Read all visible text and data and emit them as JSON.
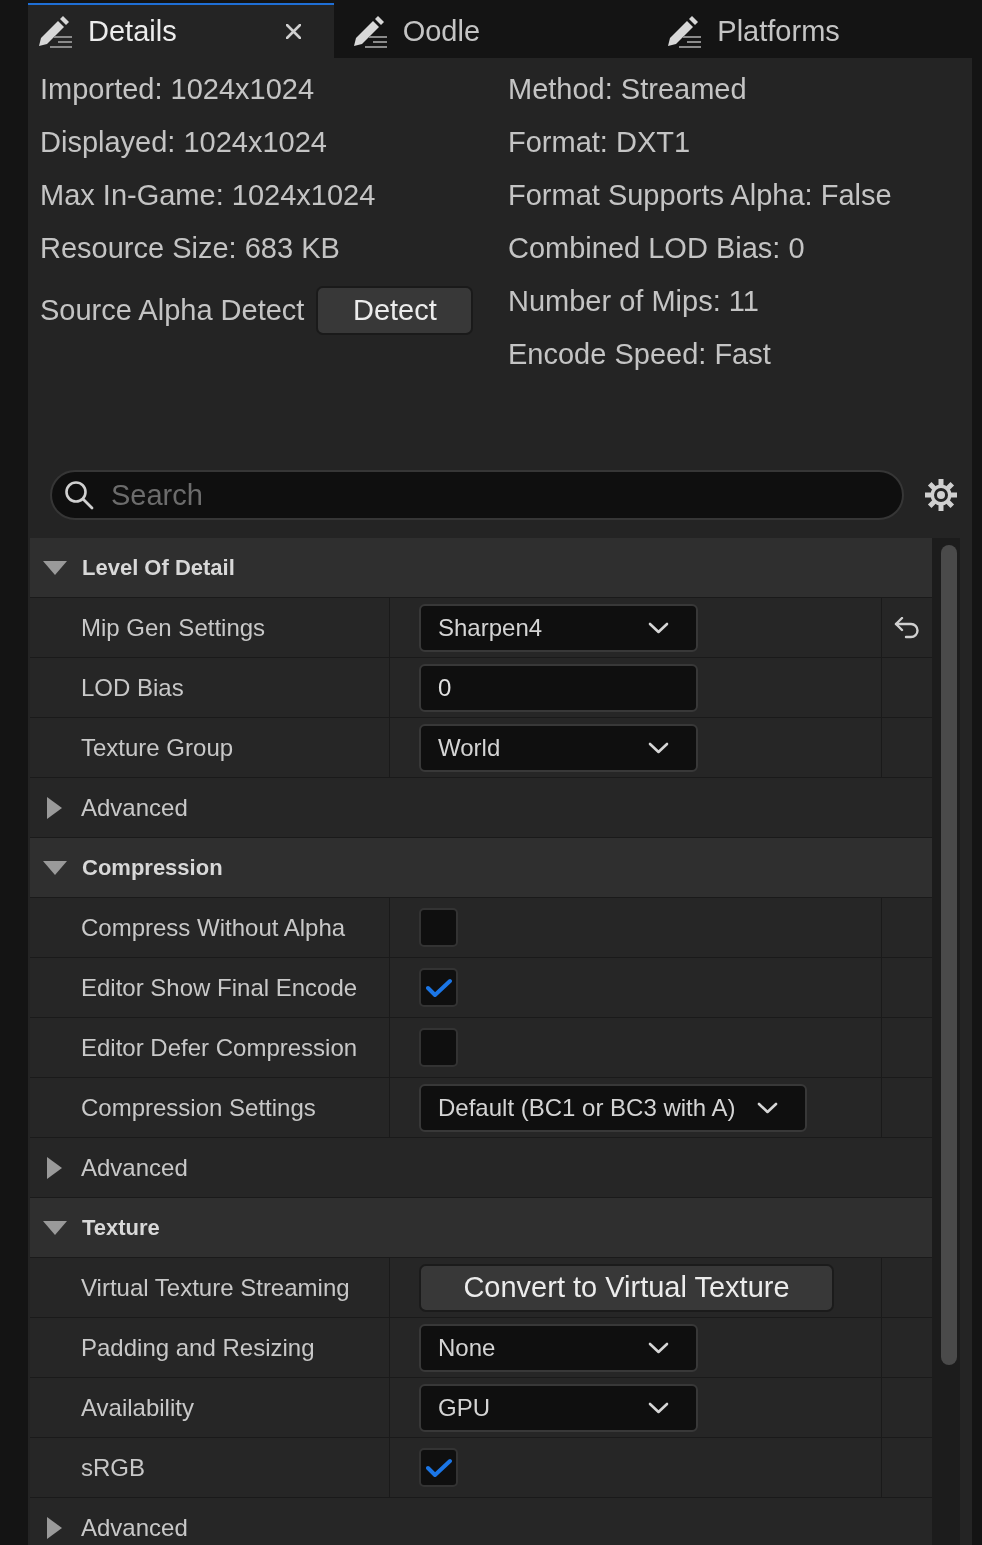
{
  "tabs": [
    {
      "label": "Details",
      "selected": true,
      "closable": true
    },
    {
      "label": "Oodle",
      "selected": false,
      "closable": false
    },
    {
      "label": "Platforms",
      "selected": false,
      "closable": false
    }
  ],
  "info": {
    "left": [
      {
        "kind": "text",
        "text": "Imported: 1024x1024"
      },
      {
        "kind": "text",
        "text": "Displayed: 1024x1024"
      },
      {
        "kind": "text",
        "text": "Max In-Game: 1024x1024"
      },
      {
        "kind": "text",
        "text": "Resource Size: 683 KB"
      },
      {
        "kind": "action",
        "text": "Source Alpha Detect",
        "button": "Detect"
      }
    ],
    "right": [
      "Method: Streamed",
      "Format: DXT1",
      "Format Supports Alpha: False",
      "Combined LOD Bias: 0",
      "Number of Mips: 11",
      "Encode Speed: Fast"
    ]
  },
  "search": {
    "placeholder": "Search"
  },
  "categories": [
    {
      "title": "Level Of Detail",
      "expanded": true,
      "properties": [
        {
          "kind": "dropdown",
          "name": "Mip Gen Settings",
          "value": "Sharpen4",
          "modified": true
        },
        {
          "kind": "number",
          "name": "LOD Bias",
          "value": "0",
          "modified": false
        },
        {
          "kind": "dropdown",
          "name": "Texture Group",
          "value": "World",
          "modified": false
        },
        {
          "kind": "group",
          "name": "Advanced",
          "expanded": false
        }
      ]
    },
    {
      "title": "Compression",
      "expanded": true,
      "properties": [
        {
          "kind": "checkbox",
          "name": "Compress Without Alpha",
          "checked": false,
          "modified": false
        },
        {
          "kind": "checkbox",
          "name": "Editor Show Final Encode",
          "checked": true,
          "modified": false
        },
        {
          "kind": "checkbox",
          "name": "Editor Defer Compression",
          "checked": false,
          "modified": false
        },
        {
          "kind": "dropdown",
          "name": "Compression Settings",
          "value": "Default (BC1 or BC3 with A)",
          "modified": false
        },
        {
          "kind": "group",
          "name": "Advanced",
          "expanded": false
        }
      ]
    },
    {
      "title": "Texture",
      "expanded": true,
      "properties": [
        {
          "kind": "button",
          "name": "Virtual Texture Streaming",
          "value": "Convert to Virtual Texture",
          "modified": false
        },
        {
          "kind": "dropdown",
          "name": "Padding and Resizing",
          "value": "None",
          "modified": false
        },
        {
          "kind": "dropdown",
          "name": "Availability",
          "value": "GPU",
          "modified": false
        },
        {
          "kind": "checkbox",
          "name": "sRGB",
          "checked": true,
          "modified": false
        },
        {
          "kind": "group",
          "name": "Advanced",
          "expanded": false
        }
      ]
    }
  ]
}
